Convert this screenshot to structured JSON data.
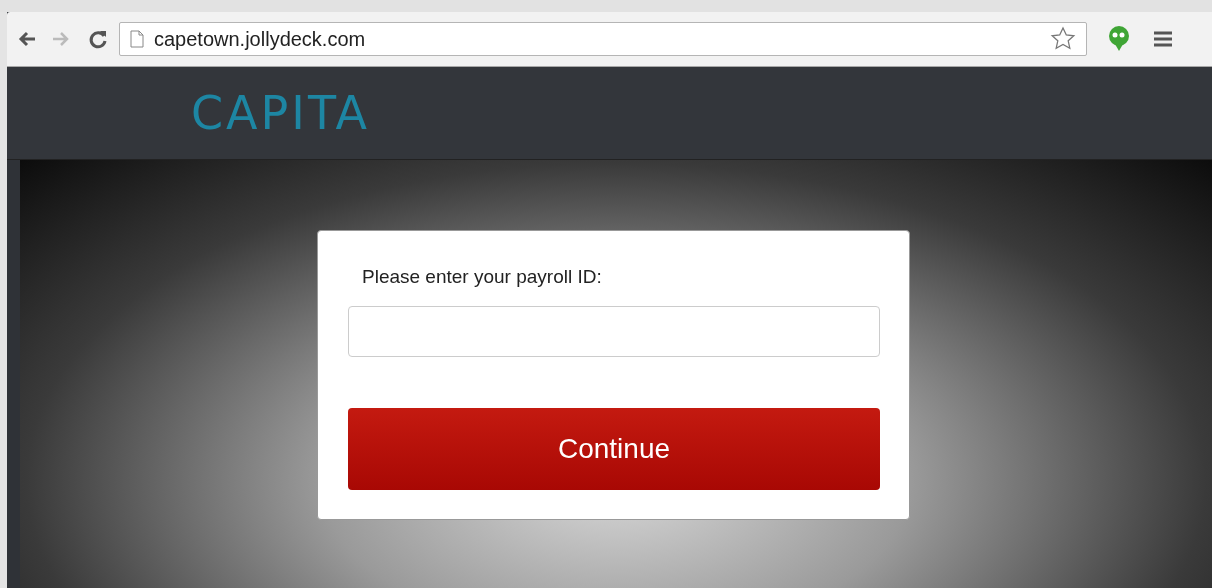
{
  "browser": {
    "url": "capetown.jollydeck.com"
  },
  "header": {
    "logo": "CAPITA"
  },
  "form": {
    "label": "Please enter your payroll ID:",
    "button": "Continue"
  }
}
